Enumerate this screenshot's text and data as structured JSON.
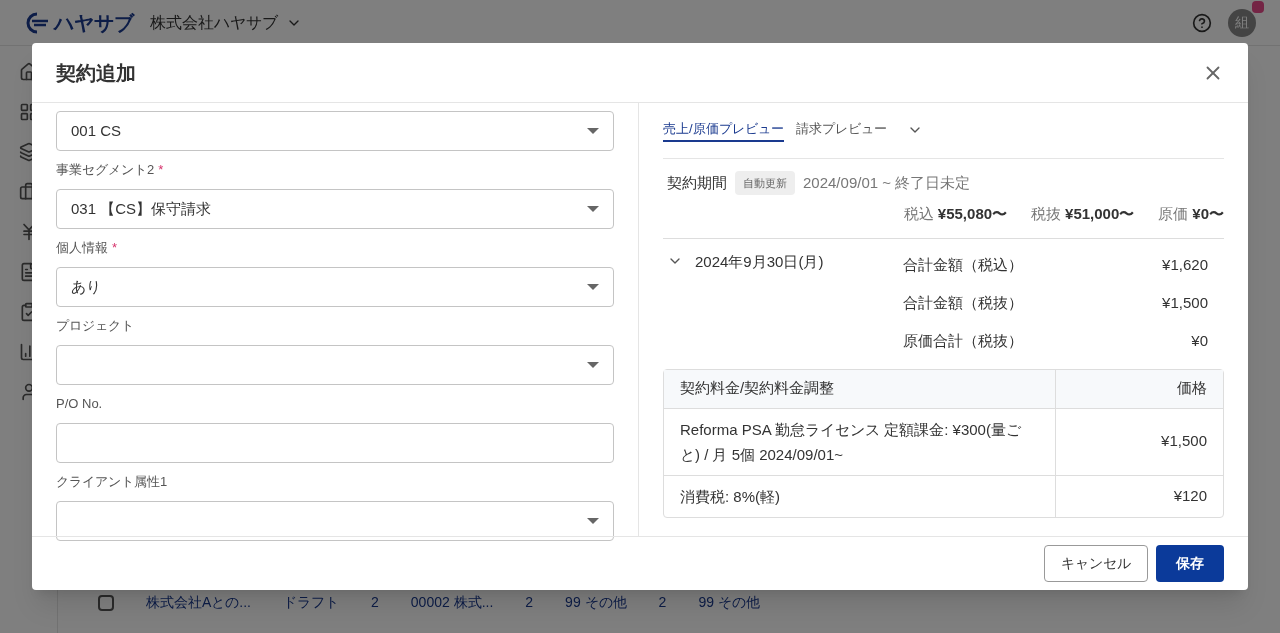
{
  "app_header": {
    "logo_text": "ハヤサブ",
    "company": "株式会社ハヤサブ",
    "avatar": "組"
  },
  "background_row": {
    "checked": false,
    "cells": [
      "株式会社Aとの...",
      "ドラフト",
      "2",
      "00002 株式...",
      "2",
      "99 その他",
      "2",
      "99 その他"
    ]
  },
  "dialog": {
    "title": "契約追加",
    "required_mark": "*",
    "fields": [
      {
        "kind": "select",
        "value": "001 CS"
      },
      {
        "label": "事業セグメント2",
        "required": true,
        "kind": "select",
        "value": "031 【CS】保守請求"
      },
      {
        "label": "個人情報",
        "required": true,
        "kind": "select",
        "value": "あり"
      },
      {
        "label": "プロジェクト",
        "required": false,
        "kind": "select"
      },
      {
        "label": "P/O No.",
        "required": false,
        "kind": "text"
      },
      {
        "label": "クライアント属性1",
        "required": false,
        "kind": "select"
      }
    ],
    "preview": {
      "tabs": [
        {
          "label": "売上/原価プレビュー",
          "selected": true
        },
        {
          "label": "請求プレビュー",
          "selected": false
        }
      ],
      "period_label": "契約期間",
      "badge": "自動更新",
      "period": "2024/09/01 ~ 終了日未定",
      "totals": [
        {
          "label": "税込",
          "value": "¥55,080〜"
        },
        {
          "label": "税抜",
          "value": "¥51,000〜"
        },
        {
          "label": "原価",
          "value": "¥0〜"
        }
      ],
      "schedule": {
        "date": "2024年9月30日(月)",
        "expanded": true,
        "rows": [
          {
            "label": "合計金額（税込）",
            "amount": "¥1,620"
          },
          {
            "label": "合計金額（税抜）",
            "amount": "¥1,500"
          },
          {
            "label": "原価合計（税抜）",
            "amount": "¥0"
          }
        ]
      },
      "table": {
        "columns": [
          "契約料金/契約料金調整",
          "価格"
        ],
        "rows": [
          {
            "item": "Reforma PSA 勤怠ライセンス 定額課金: ¥300(量ごと) / 月 5個 2024/09/01~",
            "price": "¥1,500"
          },
          {
            "item": "消費税: 8%(軽)",
            "price": "¥120"
          }
        ]
      }
    },
    "buttons": [
      {
        "label": "キャンセル",
        "kind": "secondary"
      },
      {
        "label": "保存",
        "kind": "primary"
      }
    ]
  }
}
